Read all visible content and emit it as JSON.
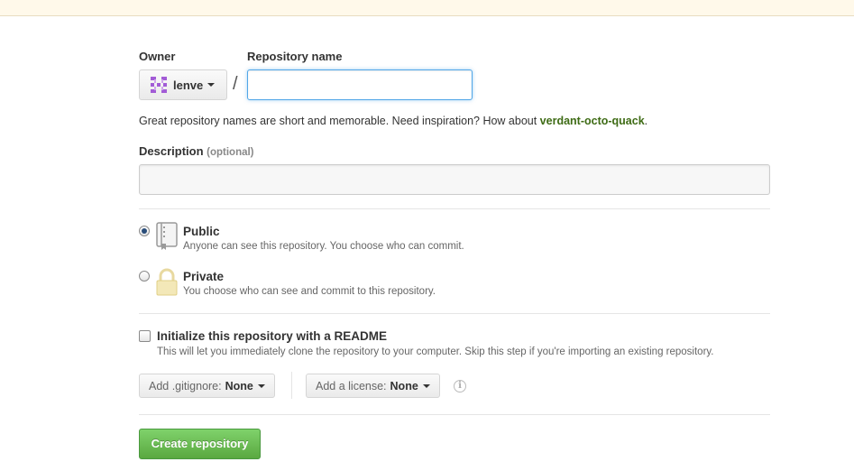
{
  "owner": {
    "label": "Owner",
    "name": "lenve"
  },
  "repo_name": {
    "label": "Repository name",
    "value": "",
    "separator": "/"
  },
  "hint": {
    "text": "Great repository names are short and memorable. Need inspiration? How about ",
    "suggestion": "verdant-octo-quack",
    "end": "."
  },
  "description": {
    "label": "Description",
    "optional": "(optional)",
    "value": ""
  },
  "visibility": {
    "selected": "public",
    "public": {
      "title": "Public",
      "desc": "Anyone can see this repository. You choose who can commit."
    },
    "private": {
      "title": "Private",
      "desc": "You choose who can see and commit to this repository."
    }
  },
  "readme": {
    "title": "Initialize this repository with a README",
    "desc": "This will let you immediately clone the repository to your computer. Skip this step if you're importing an existing repository.",
    "checked": false
  },
  "gitignore": {
    "label": "Add .gitignore:",
    "value": "None"
  },
  "license": {
    "label": "Add a license:",
    "value": "None"
  },
  "info_icon": {
    "glyph": "i"
  },
  "create_button": {
    "label": "Create repository"
  },
  "colors": {
    "accent_green": "#5aa840",
    "suggestion_green": "#3e6b15",
    "focus_blue": "#51a7e8",
    "avatar_purple": "#a25cd6"
  },
  "icons": {
    "owner_avatar": "identicon-avatar",
    "public": "repo-book-icon",
    "private": "lock-icon",
    "info": "info-icon"
  }
}
